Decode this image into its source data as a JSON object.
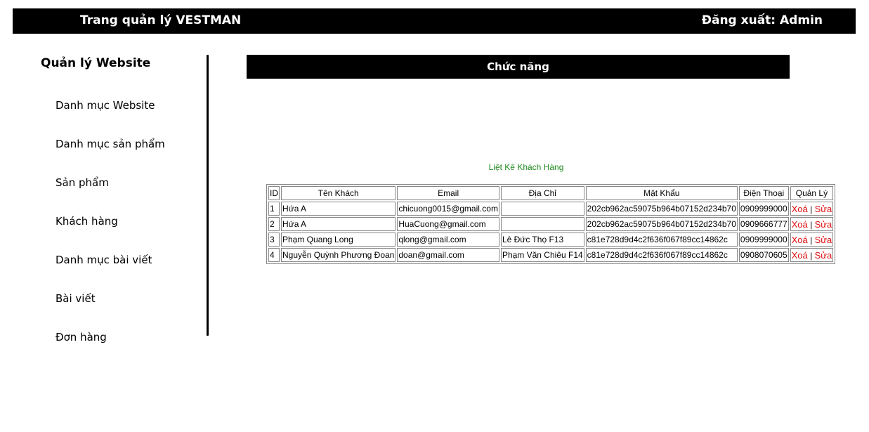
{
  "header": {
    "title": "Trang quản lý VESTMAN",
    "logout": "Đăng xuất: Admin"
  },
  "sidebar": {
    "heading": "Quản lý Website",
    "items": [
      {
        "label": "Danh mục Website"
      },
      {
        "label": "Danh mục sản phẩm"
      },
      {
        "label": "Sản phẩm"
      },
      {
        "label": "Khách hàng"
      },
      {
        "label": "Danh mục bài viết"
      },
      {
        "label": "Bài viết"
      },
      {
        "label": "Đơn hàng"
      }
    ]
  },
  "main": {
    "section_title": "Chức năng",
    "table_title": "Liệt Kê Khách Hàng",
    "columns": [
      "ID",
      "Tên Khách",
      "Email",
      "Địa Chỉ",
      "Mật Khẩu",
      "Điện Thoại",
      "Quản Lý"
    ],
    "rows": [
      {
        "id": "1",
        "name": "Hứa A",
        "email": "chicuong0015@gmail.com",
        "address": "",
        "password": "202cb962ac59075b964b07152d234b70",
        "phone": "0909999000"
      },
      {
        "id": "2",
        "name": "Hứa A",
        "email": "HuaCuong@gmail.com",
        "address": "",
        "password": "202cb962ac59075b964b07152d234b70",
        "phone": "0909666777"
      },
      {
        "id": "3",
        "name": "Phạm Quang Long",
        "email": "qlong@gmail.com",
        "address": "Lê Đức Thọ F13",
        "password": "c81e728d9d4c2f636f067f89cc14862c",
        "phone": "0909999000"
      },
      {
        "id": "4",
        "name": "Nguyễn Quỳnh Phương Đoan",
        "email": "doan@gmail.com",
        "address": "Phạm Văn Chiêu F14",
        "password": "c81e728d9d4c2f636f067f89cc14862c",
        "phone": "0908070605"
      }
    ],
    "actions": {
      "delete": "Xoá",
      "separator": "|",
      "edit": "Sửa"
    }
  }
}
